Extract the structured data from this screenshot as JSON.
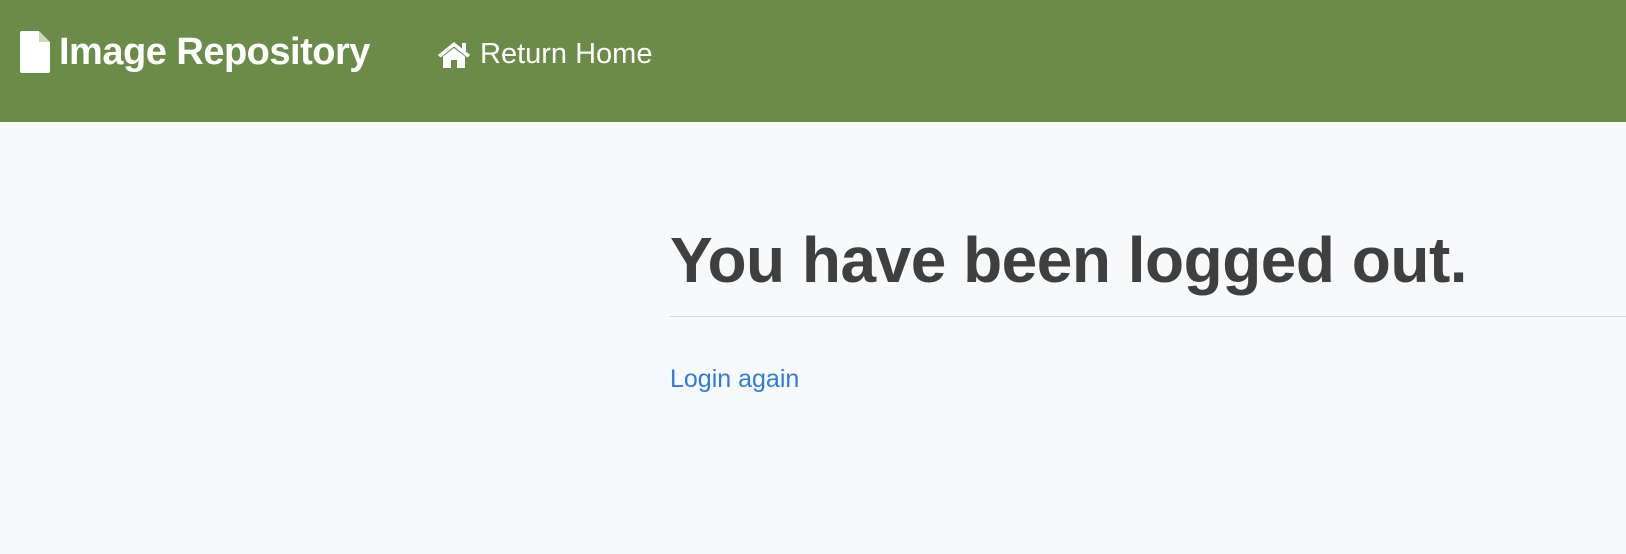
{
  "navbar": {
    "brand_label": "Image Repository",
    "brand_icon": "file-icon",
    "home_link_label": "Return Home",
    "home_icon": "home-icon",
    "background_color": "#6a8c48"
  },
  "main": {
    "title": "You have been logged out.",
    "login_link_label": "Login again",
    "link_color": "#2f7be0"
  }
}
